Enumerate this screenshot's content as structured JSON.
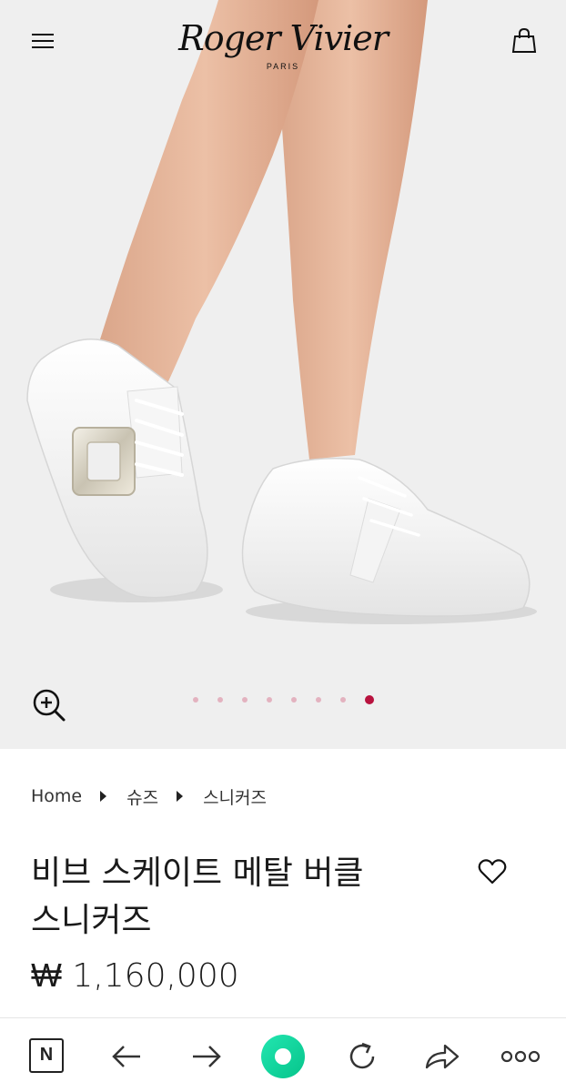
{
  "header": {
    "brand": "Roger Vivier",
    "brand_sub": "PARIS"
  },
  "gallery": {
    "image_count": 8,
    "active_index": 7
  },
  "breadcrumb": {
    "items": [
      "Home",
      "슈즈",
      "스니커즈"
    ]
  },
  "product": {
    "title_line1": "비브 스케이트 메탈 버클",
    "title_line2": "스니커즈",
    "price": "₩ 1,160,000"
  },
  "browser_bar": {
    "n_label": "N"
  },
  "colors": {
    "hero_bg": "#efefef",
    "dot_inactive": "#e3b2bf",
    "dot_active": "#b8123e",
    "accent_green": "#12d6a0"
  }
}
